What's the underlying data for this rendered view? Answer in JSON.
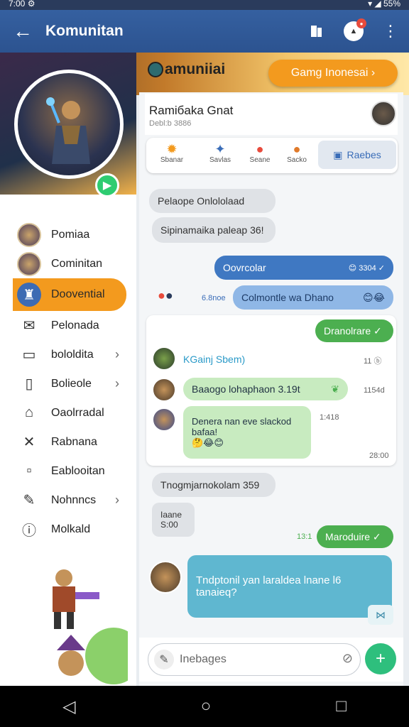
{
  "statusbar": {
    "left": "7:00 ⚙",
    "right": "▾ ◢ 55%"
  },
  "appbar": {
    "title": "Komunitan"
  },
  "banner": {
    "logo": "amuniiai",
    "pill": "Gamg Inonesai ›"
  },
  "sidebar": {
    "items": [
      {
        "label": "Pomiaa",
        "icon": "avatar-icon",
        "chev": false
      },
      {
        "label": "Cominitan",
        "icon": "avatar-icon",
        "chev": false
      },
      {
        "label": "Doovential",
        "icon": "tower-icon",
        "chev": false,
        "active": true
      },
      {
        "label": "Pelonada",
        "icon": "mail-icon",
        "chev": false
      },
      {
        "label": "bololdita",
        "icon": "box-icon",
        "chev": true
      },
      {
        "label": "Bolieole",
        "icon": "doc-icon",
        "chev": true
      },
      {
        "label": "Oaolrradal",
        "icon": "hat-icon",
        "chev": false
      },
      {
        "label": "Rabnana",
        "icon": "cross-icon",
        "chev": false
      },
      {
        "label": "Eablooitan",
        "icon": "file-icon",
        "chev": false
      },
      {
        "label": "Nohnncs",
        "icon": "pen-icon",
        "chev": true
      },
      {
        "label": "Molkald",
        "icon": "info-icon",
        "chev": false
      }
    ]
  },
  "card": {
    "title": "Ramiбaka Gnat",
    "sub": "Debl:b 3886"
  },
  "quick": {
    "items": [
      "Sbanar",
      "Savlas",
      "Seane",
      "Sacko"
    ],
    "button": "Raebes"
  },
  "messages": {
    "m1": "Pelaope Onlololaad",
    "m2": "Sipinamaika paleap 36!",
    "m3": "Oovrcolar",
    "m3_time": "😊 3304 ✓",
    "m4_time": "6.8noe",
    "m4": "Colmontle wa Dhano",
    "m5": "Dranolrare ✓",
    "m6": "KGainj Sbem)",
    "m6_time": "11 ⓑ",
    "m7": "Baaogo lohaphaon 3.19t",
    "m7_time": "1154d",
    "m8_line1": "Denera nan eve slackod",
    "m8_line2": "bafaa!",
    "m8_emoji": "🤔😂😊",
    "m8_time": "1:418",
    "m8_time2": "28:00",
    "m9": "Tnogmjarnokolam 359",
    "m10_line1": "Iaane",
    "m10_line2": "S:00",
    "m11": "Maroduire ✓",
    "m11_time": "13:1",
    "m12_line1": "Tndptonil yan laraldea lnane l6",
    "m12_line2": "tanaieq?"
  },
  "input": {
    "placeholder": "Inebages"
  }
}
